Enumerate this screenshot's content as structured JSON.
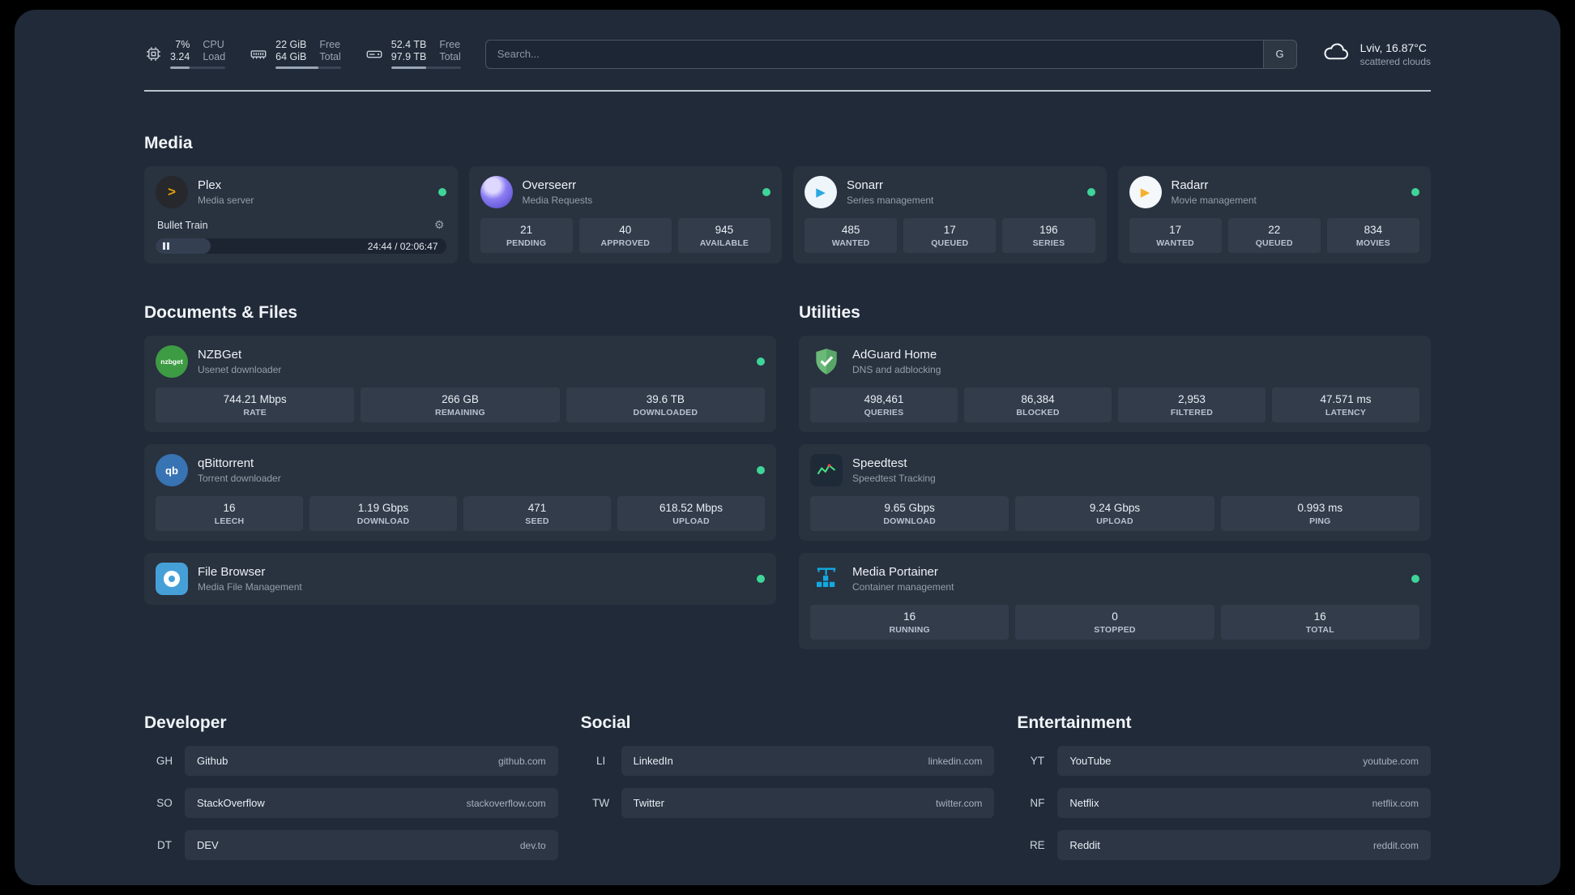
{
  "topbar": {
    "resources": [
      {
        "icon": "cpu-icon",
        "value1": "7%",
        "label1": "CPU",
        "value2": "3.24",
        "label2": "Load",
        "progress_pct": 35
      },
      {
        "icon": "memory-icon",
        "value1": "22 GiB",
        "label1": "Free",
        "value2": "64 GiB",
        "label2": "Total",
        "progress_pct": 65
      },
      {
        "icon": "disk-icon",
        "value1": "52.4 TB",
        "label1": "Free",
        "value2": "97.9 TB",
        "label2": "Total",
        "progress_pct": 50
      }
    ],
    "search": {
      "placeholder": "Search...",
      "provider_button": "G"
    },
    "weather": {
      "icon": "cloud-icon",
      "location": "Lviv, 16.87°C",
      "condition": "scattered clouds"
    }
  },
  "media": {
    "title": "Media",
    "services": [
      {
        "name": "Plex",
        "subtitle": "Media server",
        "icon": "plex-icon",
        "status": "online",
        "player": {
          "track": "Bullet Train",
          "time": "24:44 / 02:06:47",
          "progress_pct": 19
        }
      },
      {
        "name": "Overseerr",
        "subtitle": "Media Requests",
        "icon": "overseerr-icon",
        "status": "online",
        "stats": [
          {
            "value": "21",
            "label": "PENDING"
          },
          {
            "value": "40",
            "label": "APPROVED"
          },
          {
            "value": "945",
            "label": "AVAILABLE"
          }
        ]
      },
      {
        "name": "Sonarr",
        "subtitle": "Series management",
        "icon": "sonarr-icon",
        "status": "online",
        "stats": [
          {
            "value": "485",
            "label": "WANTED"
          },
          {
            "value": "17",
            "label": "QUEUED"
          },
          {
            "value": "196",
            "label": "SERIES"
          }
        ]
      },
      {
        "name": "Radarr",
        "subtitle": "Movie management",
        "icon": "radarr-icon",
        "status": "online",
        "stats": [
          {
            "value": "17",
            "label": "WANTED"
          },
          {
            "value": "22",
            "label": "QUEUED"
          },
          {
            "value": "834",
            "label": "MOVIES"
          }
        ]
      }
    ]
  },
  "documents": {
    "title": "Documents & Files",
    "services": [
      {
        "name": "NZBGet",
        "subtitle": "Usenet downloader",
        "icon": "nzbget-icon",
        "status": "online",
        "stats": [
          {
            "value": "744.21 Mbps",
            "label": "RATE"
          },
          {
            "value": "266 GB",
            "label": "REMAINING"
          },
          {
            "value": "39.6 TB",
            "label": "DOWNLOADED"
          }
        ]
      },
      {
        "name": "qBittorrent",
        "subtitle": "Torrent downloader",
        "icon": "qbittorrent-icon",
        "status": "online",
        "stats": [
          {
            "value": "16",
            "label": "LEECH"
          },
          {
            "value": "1.19 Gbps",
            "label": "DOWNLOAD"
          },
          {
            "value": "471",
            "label": "SEED"
          },
          {
            "value": "618.52 Mbps",
            "label": "UPLOAD"
          }
        ]
      },
      {
        "name": "File Browser",
        "subtitle": "Media File Management",
        "icon": "filebrowser-icon",
        "status": "online",
        "stats": []
      }
    ]
  },
  "utilities": {
    "title": "Utilities",
    "services": [
      {
        "name": "AdGuard Home",
        "subtitle": "DNS and adblocking",
        "icon": "adguard-icon",
        "stats": [
          {
            "value": "498,461",
            "label": "QUERIES"
          },
          {
            "value": "86,384",
            "label": "BLOCKED"
          },
          {
            "value": "2,953",
            "label": "FILTERED"
          },
          {
            "value": "47.571 ms",
            "label": "LATENCY"
          }
        ]
      },
      {
        "name": "Speedtest",
        "subtitle": "Speedtest Tracking",
        "icon": "speedtest-icon",
        "stats": [
          {
            "value": "9.65 Gbps",
            "label": "DOWNLOAD"
          },
          {
            "value": "9.24 Gbps",
            "label": "UPLOAD"
          },
          {
            "value": "0.993 ms",
            "label": "PING"
          }
        ]
      },
      {
        "name": "Media Portainer",
        "subtitle": "Container management",
        "icon": "portainer-icon",
        "status": "online",
        "stats": [
          {
            "value": "16",
            "label": "RUNNING"
          },
          {
            "value": "0",
            "label": "STOPPED"
          },
          {
            "value": "16",
            "label": "TOTAL"
          }
        ]
      }
    ]
  },
  "bookmarks": [
    {
      "title": "Developer",
      "links": [
        {
          "abbr": "GH",
          "name": "Github",
          "domain": "github.com"
        },
        {
          "abbr": "SO",
          "name": "StackOverflow",
          "domain": "stackoverflow.com"
        },
        {
          "abbr": "DT",
          "name": "DEV",
          "domain": "dev.to"
        }
      ]
    },
    {
      "title": "Social",
      "links": [
        {
          "abbr": "LI",
          "name": "LinkedIn",
          "domain": "linkedin.com"
        },
        {
          "abbr": "TW",
          "name": "Twitter",
          "domain": "twitter.com"
        }
      ]
    },
    {
      "title": "Entertainment",
      "links": [
        {
          "abbr": "YT",
          "name": "YouTube",
          "domain": "youtube.com"
        },
        {
          "abbr": "NF",
          "name": "Netflix",
          "domain": "netflix.com"
        },
        {
          "abbr": "RE",
          "name": "Reddit",
          "domain": "reddit.com"
        }
      ]
    }
  ],
  "logos": {
    "nzbget_text": "nzbget",
    "qbittorrent_text": "qb",
    "plex_chevron": ">",
    "play_glyph": "▶",
    "gear_glyph": "⚙"
  },
  "colors": {
    "status_online": "#3ed598",
    "plex_accent": "#e5a00d",
    "background": "#202a38",
    "card": "#29323f"
  }
}
